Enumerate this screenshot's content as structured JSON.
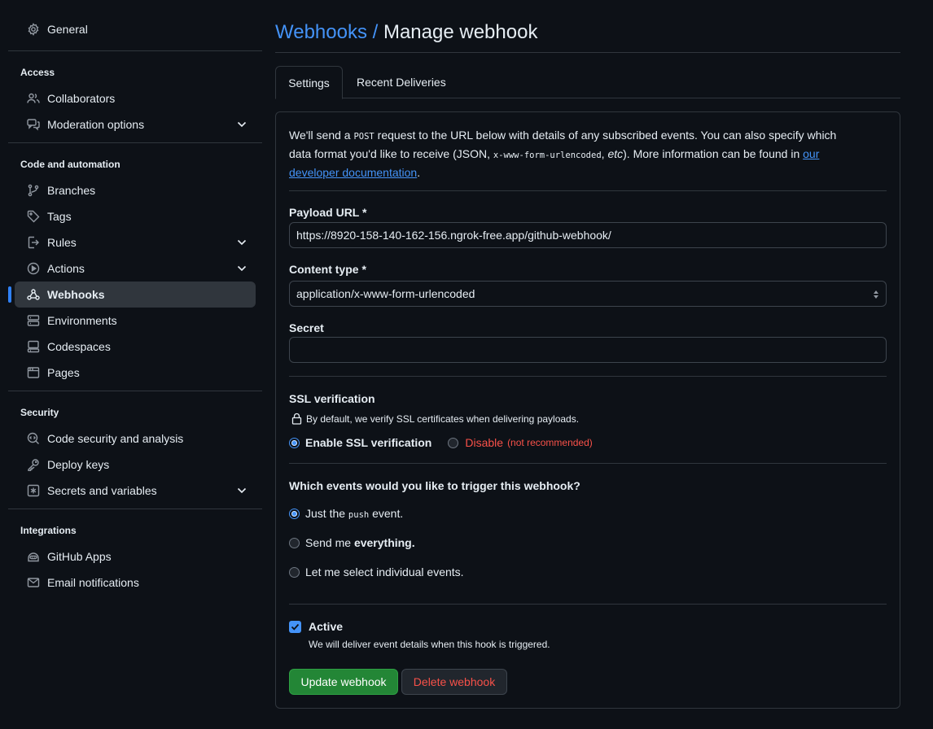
{
  "sidebar": {
    "general": "General",
    "sections": {
      "access": "Access",
      "code": "Code and automation",
      "security": "Security",
      "integrations": "Integrations"
    },
    "items": {
      "collaborators": "Collaborators",
      "moderation": "Moderation options",
      "branches": "Branches",
      "tags": "Tags",
      "rules": "Rules",
      "actions": "Actions",
      "webhooks": "Webhooks",
      "environments": "Environments",
      "codespaces": "Codespaces",
      "pages": "Pages",
      "code_security": "Code security and analysis",
      "deploy_keys": "Deploy keys",
      "secrets": "Secrets and variables",
      "github_apps": "GitHub Apps",
      "email_notifications": "Email notifications"
    },
    "active": "webhooks"
  },
  "header": {
    "crumb": "Webhooks /",
    "title": "Manage webhook"
  },
  "tabs": {
    "settings": "Settings",
    "recent": "Recent Deliveries"
  },
  "intro": {
    "p1": "We'll send a ",
    "post": "POST",
    "p2": " request to the URL below with details of any subscribed events. You can also specify which data format you'd like to receive (JSON, ",
    "form": "x-www-form-urlencoded",
    "p3": ", ",
    "etc": "etc",
    "p4": "). More information can be found in ",
    "link": "our developer documentation",
    "p5": "."
  },
  "payload": {
    "label": "Payload URL *",
    "value": "https://8920-158-140-162-156.ngrok-free.app/github-webhook/"
  },
  "content_type": {
    "label": "Content type *",
    "value": "application/x-www-form-urlencoded"
  },
  "secret": {
    "label": "Secret",
    "value": ""
  },
  "ssl": {
    "label": "SSL verification",
    "note": "By default, we verify SSL certificates when delivering payloads.",
    "enable": "Enable SSL verification",
    "disable": "Disable",
    "not_recommended": "(not recommended)"
  },
  "events": {
    "question": "Which events would you like to trigger this webhook?",
    "push_pre": "Just the ",
    "push_code": "push",
    "push_post": " event.",
    "everything_pre": "Send me ",
    "everything_bold": "everything.",
    "individual": "Let me select individual events.",
    "selected": "push"
  },
  "active": {
    "label": "Active",
    "note": "We will deliver event details when this hook is triggered.",
    "checked": true
  },
  "buttons": {
    "update": "Update webhook",
    "delete": "Delete webhook"
  },
  "colors": {
    "accent": "#4493f8",
    "green": "#238636",
    "danger": "#f85149",
    "bg": "#0d1117"
  }
}
